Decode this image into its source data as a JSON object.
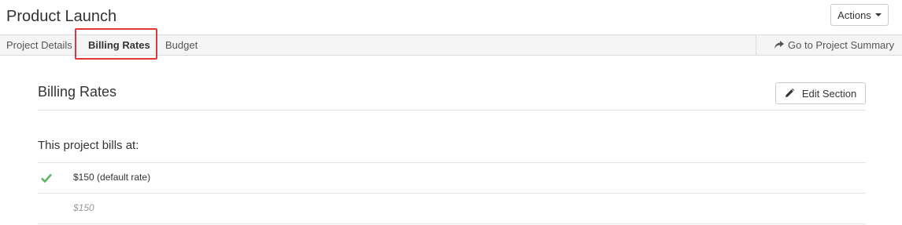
{
  "header": {
    "title": "Product Launch",
    "actions_label": "Actions"
  },
  "tabs": {
    "items": [
      {
        "label": "Project Details"
      },
      {
        "label": "Billing Rates",
        "active": true
      },
      {
        "label": "Budget"
      }
    ],
    "summary_link": "Go to Project Summary"
  },
  "section": {
    "title": "Billing Rates",
    "edit_label": "Edit Section",
    "bills_label": "This project bills at:",
    "rates": [
      {
        "text": "$150 (default rate)",
        "icon": "check-icon",
        "icon_color": "#5cb85c"
      }
    ],
    "rate_value": "$150"
  },
  "colors": {
    "highlight": "#e0383b",
    "check": "#5cb85c",
    "muted": "#999999"
  }
}
